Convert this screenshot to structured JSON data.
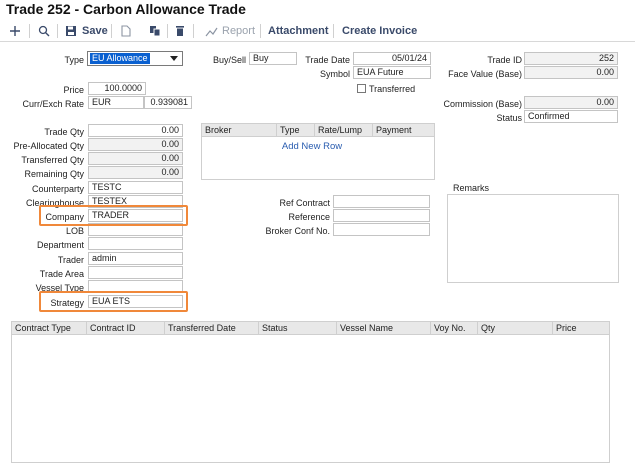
{
  "title": "Trade 252 - Carbon Allowance Trade",
  "toolbar": {
    "save": "Save",
    "report": "Report",
    "attachment": "Attachment",
    "create_invoice": "Create Invoice"
  },
  "header": {
    "type_label": "Type",
    "type_value": "EU Allowance",
    "buysell_label": "Buy/Sell",
    "buysell_value": "Buy",
    "tradedate_label": "Trade Date",
    "tradedate_value": "05/01/24",
    "symbol_label": "Symbol",
    "symbol_value": "EUA Future",
    "transferred_label": "Transferred",
    "tradeid_label": "Trade ID",
    "tradeid_value": "252",
    "facevalue_label": "Face Value (Base)",
    "facevalue_value": "0.00",
    "price_label": "Price",
    "price_value": "100.0000",
    "curr_label": "Curr/Exch Rate",
    "curr_value": "EUR",
    "exch_value": "0.939081",
    "commission_label": "Commission (Base)",
    "commission_value": "0.00",
    "status_label": "Status",
    "status_value": "Confirmed"
  },
  "qty": {
    "trade_qty_label": "Trade Qty",
    "trade_qty_value": "0.00",
    "prealloc_label": "Pre-Allocated Qty",
    "prealloc_value": "0.00",
    "transferred_label": "Transferred Qty",
    "transferred_value": "0.00",
    "remaining_label": "Remaining Qty",
    "remaining_value": "0.00"
  },
  "party": {
    "counterparty_label": "Counterparty",
    "counterparty_value": "TESTC",
    "clearinghouse_label": "Clearinghouse",
    "clearinghouse_value": "TESTEX",
    "company_label": "Company",
    "company_value": "TRADER",
    "lob_label": "LOB",
    "lob_value": "",
    "department_label": "Department",
    "department_value": "",
    "trader_label": "Trader",
    "trader_value": "admin",
    "tradearea_label": "Trade Area",
    "tradearea_value": "",
    "vesseltype_label": "Vessel Type",
    "vesseltype_value": "",
    "strategy_label": "Strategy",
    "strategy_value": "EUA ETS"
  },
  "broker_grid": {
    "columns": [
      "Broker",
      "Type",
      "Rate/Lump",
      "Payment"
    ],
    "add_new_row": "Add New Row"
  },
  "refs": {
    "ref_contract_label": "Ref Contract",
    "ref_contract_value": "",
    "reference_label": "Reference",
    "reference_value": "",
    "broker_conf_label": "Broker Conf No.",
    "broker_conf_value": ""
  },
  "remarks_label": "Remarks",
  "contracts_grid": {
    "columns": [
      "Contract Type",
      "Contract ID",
      "Transferred Date",
      "Status",
      "Vessel Name",
      "Voy No.",
      "Qty",
      "Price"
    ]
  }
}
